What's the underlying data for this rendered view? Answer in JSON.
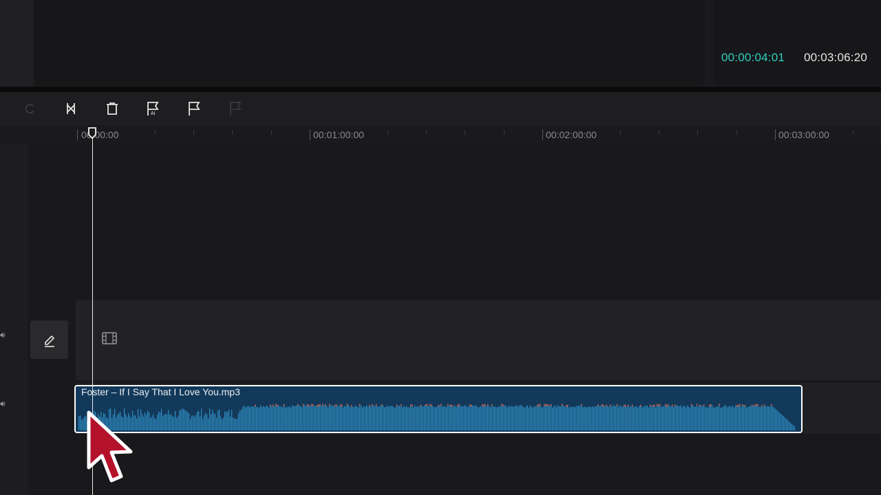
{
  "preview": {
    "time_current": "00:00:04:01",
    "time_total": "00:03:06:20",
    "time_current_color": "#2fd0c0"
  },
  "toolbar": {
    "buttons": [
      {
        "name": "redo-icon",
        "enabled": false
      },
      {
        "name": "split-icon",
        "enabled": true
      },
      {
        "name": "delete-icon",
        "enabled": true
      },
      {
        "name": "ai-marker-icon",
        "enabled": true
      },
      {
        "name": "marker-flag-icon",
        "enabled": true
      },
      {
        "name": "marker-disabled-icon",
        "enabled": false
      }
    ]
  },
  "ruler": {
    "labels": [
      "00:00:00",
      "00:01:00:00",
      "00:02:00:00",
      "00:03:00:00"
    ]
  },
  "tracks": {
    "video_track": {
      "edit_icon": "pencil-icon",
      "placeholder_icon": "film-icon"
    },
    "audio_track": {
      "clip_label": "Foster – If I Say That I Love You.mp3",
      "clip_color": "#13395a",
      "wave_color": "#2f8fc4",
      "peak_color": "#e0664a"
    }
  },
  "accent": {
    "selection": "#ffffff",
    "cursor": "#b4122b"
  }
}
